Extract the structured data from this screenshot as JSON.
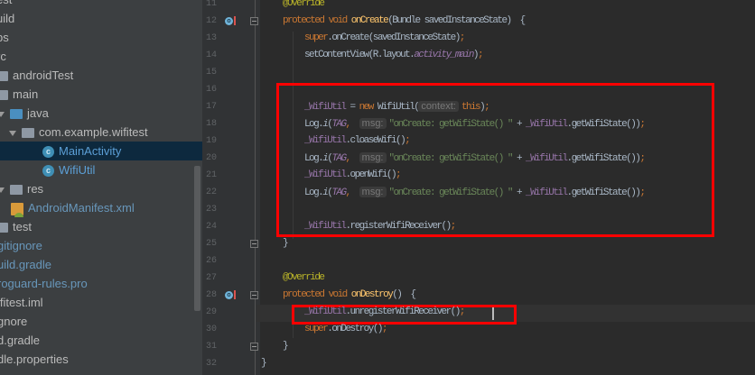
{
  "project_tree": [
    {
      "label": "est",
      "indent": -4,
      "icon": "none",
      "style": ""
    },
    {
      "label": "uild",
      "indent": -4,
      "icon": "none",
      "style": ""
    },
    {
      "label": "bs",
      "indent": -4,
      "icon": "none",
      "style": ""
    },
    {
      "label": "rc",
      "indent": -4,
      "icon": "none",
      "style": ""
    },
    {
      "label": "androidTest",
      "indent": -5,
      "icon": "folder",
      "style": ""
    },
    {
      "label": "main",
      "indent": -5,
      "icon": "folder",
      "style": ""
    },
    {
      "label": "java",
      "indent": -3,
      "icon": "folder-blue",
      "style": "",
      "arrow": true
    },
    {
      "label": "com.example.wifitest",
      "indent": 10,
      "icon": "package",
      "style": "",
      "arrow": true
    },
    {
      "label": "MainActivity",
      "indent": 47,
      "icon": "class",
      "style": "cls",
      "selected": true
    },
    {
      "label": "WifiUtil",
      "indent": 47,
      "icon": "class",
      "style": "cls"
    },
    {
      "label": "res",
      "indent": -3,
      "icon": "folder-res",
      "style": "",
      "arrow": true
    },
    {
      "label": "AndroidManifest.xml",
      "indent": 12,
      "icon": "xml",
      "style": "blue"
    },
    {
      "label": "test",
      "indent": -5,
      "icon": "folder",
      "style": ""
    },
    {
      "label": "gitignore",
      "indent": -3,
      "icon": "none",
      "style": "blue"
    },
    {
      "label": "uild.gradle",
      "indent": -3,
      "icon": "none",
      "style": "blue"
    },
    {
      "label": "roguard-rules.pro",
      "indent": -3,
      "icon": "none",
      "style": "blue"
    },
    {
      "label": "ifitest.iml",
      "indent": -3,
      "icon": "none",
      "style": ""
    },
    {
      "label": "gnore",
      "indent": -3,
      "icon": "none",
      "style": ""
    },
    {
      "label": "d.gradle",
      "indent": -3,
      "icon": "none",
      "style": ""
    },
    {
      "label": "dle.properties",
      "indent": -3,
      "icon": "none",
      "style": ""
    }
  ],
  "editor": {
    "current_line": 29,
    "lines": [
      {
        "n": 11,
        "indent": 1,
        "tokens": [
          [
            "@Override",
            "an"
          ]
        ]
      },
      {
        "n": 12,
        "indent": 1,
        "marker": "override",
        "fold": true,
        "tokens": [
          [
            "protected void ",
            "kw"
          ],
          [
            "onCreate",
            "fn"
          ],
          [
            "(Bundle savedInstanceState)  {",
            ""
          ]
        ]
      },
      {
        "n": 13,
        "indent": 2,
        "tokens": [
          [
            "super",
            "kw"
          ],
          [
            ".onCreate(savedInstanceState)",
            ""
          ],
          [
            ";",
            "kw"
          ]
        ]
      },
      {
        "n": 14,
        "indent": 2,
        "tokens": [
          [
            "setContentView(R.layout.",
            ""
          ],
          [
            "activity_main",
            "fd it"
          ],
          [
            ")",
            ""
          ],
          [
            ";",
            "kw"
          ]
        ]
      },
      {
        "n": 15,
        "indent": 0,
        "tokens": []
      },
      {
        "n": 16,
        "indent": 0,
        "tokens": []
      },
      {
        "n": 17,
        "indent": 2,
        "tokens": [
          [
            "_WifiUtil",
            "fd"
          ],
          [
            " = ",
            ""
          ],
          [
            "new ",
            "kw"
          ],
          [
            "WifiUtil(",
            ""
          ],
          [
            "context:",
            "hint"
          ],
          [
            "this",
            "kw"
          ],
          [
            ")",
            ""
          ],
          [
            ";",
            "kw"
          ]
        ]
      },
      {
        "n": 18,
        "indent": 2,
        "tokens": [
          [
            "Log.",
            ""
          ],
          [
            "i",
            "it"
          ],
          [
            "(",
            ""
          ],
          [
            "TAG",
            "fd it"
          ],
          [
            ",  ",
            "kw"
          ],
          [
            "msg:",
            "hint"
          ],
          [
            "\"onCreate: getWifiState() \"",
            "st"
          ],
          [
            " + ",
            ""
          ],
          [
            "_WifiUtil",
            "fd"
          ],
          [
            ".getWifiState())",
            ""
          ],
          [
            ";",
            "kw"
          ]
        ]
      },
      {
        "n": 19,
        "indent": 2,
        "tokens": [
          [
            "_WifiUtil",
            "fd"
          ],
          [
            ".cloaseWifi()",
            ""
          ],
          [
            ";",
            "kw"
          ]
        ]
      },
      {
        "n": 20,
        "indent": 2,
        "tokens": [
          [
            "Log.",
            ""
          ],
          [
            "i",
            "it"
          ],
          [
            "(",
            ""
          ],
          [
            "TAG",
            "fd it"
          ],
          [
            ",  ",
            "kw"
          ],
          [
            "msg:",
            "hint"
          ],
          [
            "\"onCreate: getWifiState() \"",
            "st"
          ],
          [
            " + ",
            ""
          ],
          [
            "_WifiUtil",
            "fd"
          ],
          [
            ".getWifiState())",
            ""
          ],
          [
            ";",
            "kw"
          ]
        ]
      },
      {
        "n": 21,
        "indent": 2,
        "tokens": [
          [
            "_WifiUtil",
            "fd"
          ],
          [
            ".openWifi()",
            ""
          ],
          [
            ";",
            "kw"
          ]
        ]
      },
      {
        "n": 22,
        "indent": 2,
        "tokens": [
          [
            "Log.",
            ""
          ],
          [
            "i",
            "it"
          ],
          [
            "(",
            ""
          ],
          [
            "TAG",
            "fd it"
          ],
          [
            ",  ",
            "kw"
          ],
          [
            "msg:",
            "hint"
          ],
          [
            "\"onCreate: getWifiState() \"",
            "st"
          ],
          [
            " + ",
            ""
          ],
          [
            "_WifiUtil",
            "fd"
          ],
          [
            ".getWifiState())",
            ""
          ],
          [
            ";",
            "kw"
          ]
        ]
      },
      {
        "n": 23,
        "indent": 0,
        "tokens": []
      },
      {
        "n": 24,
        "indent": 2,
        "tokens": [
          [
            "_WifiUtil",
            "fd"
          ],
          [
            ".registerWifiReceiver()",
            ""
          ],
          [
            ";",
            "kw"
          ]
        ]
      },
      {
        "n": 25,
        "indent": 1,
        "fold": true,
        "tokens": [
          [
            "}",
            ""
          ]
        ]
      },
      {
        "n": 26,
        "indent": 0,
        "tokens": []
      },
      {
        "n": 27,
        "indent": 1,
        "tokens": [
          [
            "@Override",
            "an"
          ]
        ]
      },
      {
        "n": 28,
        "indent": 1,
        "marker": "override",
        "fold": true,
        "tokens": [
          [
            "protected void ",
            "kw"
          ],
          [
            "onDestroy",
            "fn"
          ],
          [
            "()  {",
            ""
          ]
        ]
      },
      {
        "n": 29,
        "indent": 2,
        "tokens": [
          [
            "_WifiUtil",
            "fd"
          ],
          [
            ".unregisterWifiReceiver()",
            ""
          ],
          [
            ";",
            "kw"
          ]
        ]
      },
      {
        "n": 30,
        "indent": 2,
        "tokens": [
          [
            "super",
            "kw"
          ],
          [
            ".onDestroy()",
            ""
          ],
          [
            ";",
            "kw"
          ]
        ]
      },
      {
        "n": 31,
        "indent": 1,
        "fold": true,
        "tokens": [
          [
            "}",
            ""
          ]
        ]
      },
      {
        "n": 32,
        "indent": 0,
        "tokens": [
          [
            "}",
            ""
          ]
        ]
      }
    ]
  },
  "colors": {
    "highlight_box": "#ff0000",
    "keyword": "#cc7832",
    "field": "#9876aa",
    "string": "#6a8759",
    "annotation": "#bbb529"
  }
}
